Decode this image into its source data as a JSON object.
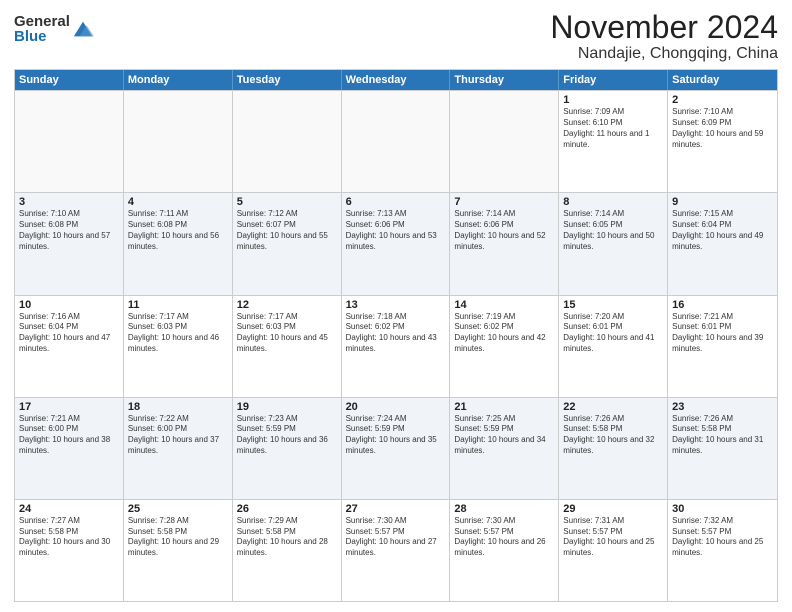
{
  "header": {
    "logo_general": "General",
    "logo_blue": "Blue",
    "month": "November 2024",
    "location": "Nandajie, Chongqing, China"
  },
  "weekdays": [
    "Sunday",
    "Monday",
    "Tuesday",
    "Wednesday",
    "Thursday",
    "Friday",
    "Saturday"
  ],
  "rows": [
    [
      {
        "day": "",
        "info": ""
      },
      {
        "day": "",
        "info": ""
      },
      {
        "day": "",
        "info": ""
      },
      {
        "day": "",
        "info": ""
      },
      {
        "day": "",
        "info": ""
      },
      {
        "day": "1",
        "info": "Sunrise: 7:09 AM\nSunset: 6:10 PM\nDaylight: 11 hours and 1 minute."
      },
      {
        "day": "2",
        "info": "Sunrise: 7:10 AM\nSunset: 6:09 PM\nDaylight: 10 hours and 59 minutes."
      }
    ],
    [
      {
        "day": "3",
        "info": "Sunrise: 7:10 AM\nSunset: 6:08 PM\nDaylight: 10 hours and 57 minutes."
      },
      {
        "day": "4",
        "info": "Sunrise: 7:11 AM\nSunset: 6:08 PM\nDaylight: 10 hours and 56 minutes."
      },
      {
        "day": "5",
        "info": "Sunrise: 7:12 AM\nSunset: 6:07 PM\nDaylight: 10 hours and 55 minutes."
      },
      {
        "day": "6",
        "info": "Sunrise: 7:13 AM\nSunset: 6:06 PM\nDaylight: 10 hours and 53 minutes."
      },
      {
        "day": "7",
        "info": "Sunrise: 7:14 AM\nSunset: 6:06 PM\nDaylight: 10 hours and 52 minutes."
      },
      {
        "day": "8",
        "info": "Sunrise: 7:14 AM\nSunset: 6:05 PM\nDaylight: 10 hours and 50 minutes."
      },
      {
        "day": "9",
        "info": "Sunrise: 7:15 AM\nSunset: 6:04 PM\nDaylight: 10 hours and 49 minutes."
      }
    ],
    [
      {
        "day": "10",
        "info": "Sunrise: 7:16 AM\nSunset: 6:04 PM\nDaylight: 10 hours and 47 minutes."
      },
      {
        "day": "11",
        "info": "Sunrise: 7:17 AM\nSunset: 6:03 PM\nDaylight: 10 hours and 46 minutes."
      },
      {
        "day": "12",
        "info": "Sunrise: 7:17 AM\nSunset: 6:03 PM\nDaylight: 10 hours and 45 minutes."
      },
      {
        "day": "13",
        "info": "Sunrise: 7:18 AM\nSunset: 6:02 PM\nDaylight: 10 hours and 43 minutes."
      },
      {
        "day": "14",
        "info": "Sunrise: 7:19 AM\nSunset: 6:02 PM\nDaylight: 10 hours and 42 minutes."
      },
      {
        "day": "15",
        "info": "Sunrise: 7:20 AM\nSunset: 6:01 PM\nDaylight: 10 hours and 41 minutes."
      },
      {
        "day": "16",
        "info": "Sunrise: 7:21 AM\nSunset: 6:01 PM\nDaylight: 10 hours and 39 minutes."
      }
    ],
    [
      {
        "day": "17",
        "info": "Sunrise: 7:21 AM\nSunset: 6:00 PM\nDaylight: 10 hours and 38 minutes."
      },
      {
        "day": "18",
        "info": "Sunrise: 7:22 AM\nSunset: 6:00 PM\nDaylight: 10 hours and 37 minutes."
      },
      {
        "day": "19",
        "info": "Sunrise: 7:23 AM\nSunset: 5:59 PM\nDaylight: 10 hours and 36 minutes."
      },
      {
        "day": "20",
        "info": "Sunrise: 7:24 AM\nSunset: 5:59 PM\nDaylight: 10 hours and 35 minutes."
      },
      {
        "day": "21",
        "info": "Sunrise: 7:25 AM\nSunset: 5:59 PM\nDaylight: 10 hours and 34 minutes."
      },
      {
        "day": "22",
        "info": "Sunrise: 7:26 AM\nSunset: 5:58 PM\nDaylight: 10 hours and 32 minutes."
      },
      {
        "day": "23",
        "info": "Sunrise: 7:26 AM\nSunset: 5:58 PM\nDaylight: 10 hours and 31 minutes."
      }
    ],
    [
      {
        "day": "24",
        "info": "Sunrise: 7:27 AM\nSunset: 5:58 PM\nDaylight: 10 hours and 30 minutes."
      },
      {
        "day": "25",
        "info": "Sunrise: 7:28 AM\nSunset: 5:58 PM\nDaylight: 10 hours and 29 minutes."
      },
      {
        "day": "26",
        "info": "Sunrise: 7:29 AM\nSunset: 5:58 PM\nDaylight: 10 hours and 28 minutes."
      },
      {
        "day": "27",
        "info": "Sunrise: 7:30 AM\nSunset: 5:57 PM\nDaylight: 10 hours and 27 minutes."
      },
      {
        "day": "28",
        "info": "Sunrise: 7:30 AM\nSunset: 5:57 PM\nDaylight: 10 hours and 26 minutes."
      },
      {
        "day": "29",
        "info": "Sunrise: 7:31 AM\nSunset: 5:57 PM\nDaylight: 10 hours and 25 minutes."
      },
      {
        "day": "30",
        "info": "Sunrise: 7:32 AM\nSunset: 5:57 PM\nDaylight: 10 hours and 25 minutes."
      }
    ]
  ],
  "alt_rows": [
    1,
    3
  ]
}
